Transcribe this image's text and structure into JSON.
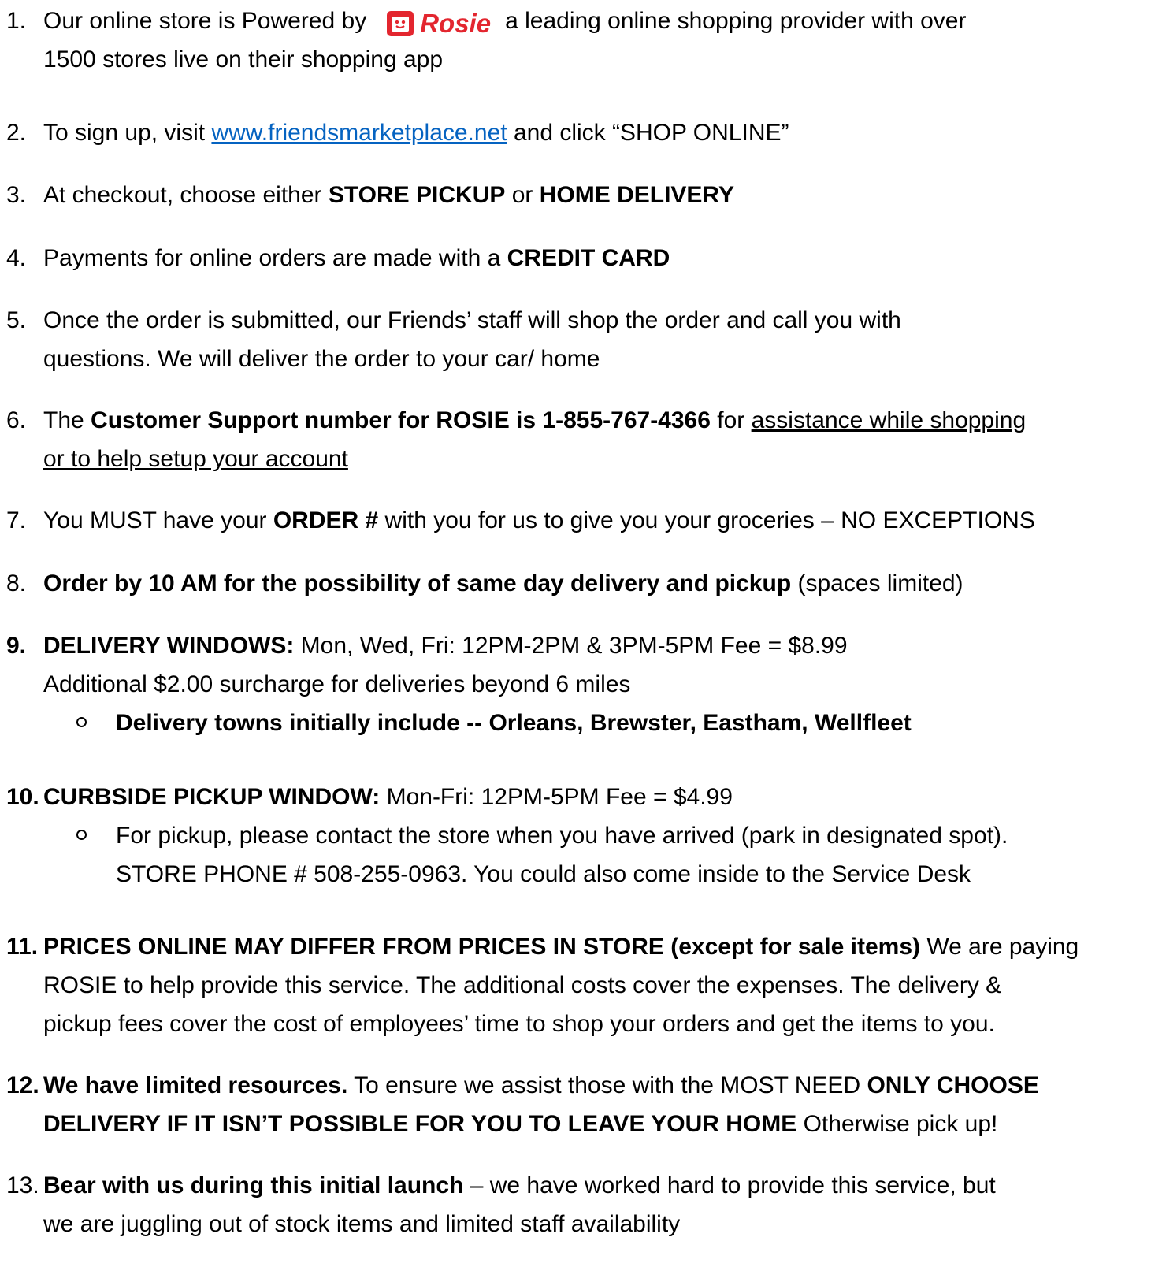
{
  "colors": {
    "text": "#000000",
    "link": "#0563c1",
    "brand": "#e3262f"
  },
  "items": [
    {
      "number": "1.",
      "before": "Our online store is Powered by",
      "logo_icon": "rosie-bag-icon",
      "logo_text": "Rosie",
      "after": "a leading online shopping provider with over",
      "line2": "1500 stores live on their shopping app"
    },
    {
      "number": "2.",
      "before": "To sign up, visit ",
      "link": "www.friendsmarketplace.net",
      "after": " and click “SHOP ONLINE”"
    },
    {
      "number": "3.",
      "before": "At checkout, choose either ",
      "bold1": "STORE PICKUP",
      "middle": " or ",
      "bold2": "HOME DELIVERY"
    },
    {
      "number": "4.",
      "before": "Payments for online orders are made with a ",
      "bold1": "CREDIT CARD"
    },
    {
      "number": "5.",
      "line1": "Once the order is submitted, our Friends’ staff will shop the order and call you with",
      "line2": "questions.  We will deliver the order to your car/ home"
    },
    {
      "number": "6.",
      "before": "The ",
      "bold1": "Customer Support number for ROSIE is 1-855-767-4366",
      "middle": " for ",
      "underline1": "assistance while shopping",
      "underline2": "or to help setup your account"
    },
    {
      "number": "7.",
      "before": "You MUST have your ",
      "bold1": "ORDER #",
      "after": " with you for us to give you your groceries – NO EXCEPTIONS"
    },
    {
      "number": "8.",
      "bold1": "Order by 10 AM for the possibility of same day delivery and pickup",
      "after": " (spaces limited)"
    },
    {
      "number": "9.",
      "bold1": "DELIVERY WINDOWS:",
      "after": "  Mon, Wed, Fri: 12PM-2PM & 3PM-5PM   Fee = $8.99",
      "line2": "Additional $2.00 surcharge for deliveries beyond 6 miles",
      "sub": "Delivery towns initially include -- Orleans, Brewster, Eastham, Wellfleet"
    },
    {
      "number": "10.",
      "bold1": "CURBSIDE PICKUP WINDOW:",
      "after": "  Mon-Fri:  12PM-5PM   Fee = $4.99",
      "sub_line1": "For pickup, please contact the store when you have arrived (park in designated spot).",
      "sub_line2": "STORE PHONE # 508-255-0963.  You could also come inside to the Service Desk"
    },
    {
      "number": "11.",
      "bold1": "PRICES ONLINE MAY DIFFER FROM PRICES IN STORE (except for sale items)",
      "after": " We are paying",
      "line2": "ROSIE to help provide this service.  The additional costs cover the expenses.  The delivery &",
      "line3": "pickup fees cover the cost of employees’ time to shop your orders and get the items to you."
    },
    {
      "number": "12.",
      "bold1": "We have limited resources.",
      "middle": "  To ensure we assist those with the MOST NEED ",
      "bold2": "ONLY CHOOSE",
      "line2_bold": "DELIVERY IF IT ISN’T POSSIBLE FOR YOU TO LEAVE YOUR HOME",
      "line2_after": "  Otherwise pick up!"
    },
    {
      "number": "13.",
      "bold1": "Bear with us during this initial launch",
      "after": " – we have worked hard to provide this service, but",
      "line2": "we are juggling out of stock items and limited staff availability"
    }
  ]
}
